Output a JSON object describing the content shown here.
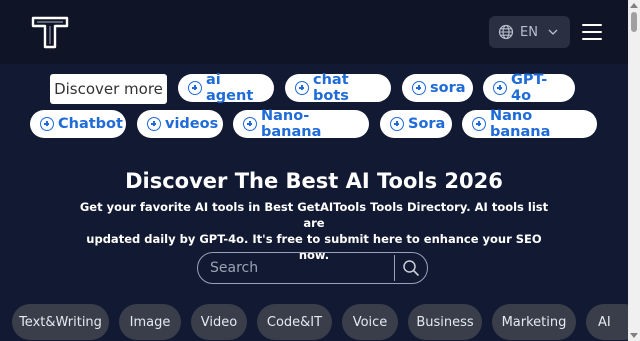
{
  "header": {
    "logo_letter": "T",
    "language": "EN"
  },
  "tags": {
    "discover_label": "Discover more",
    "row1": [
      "ai agent",
      "chat bots",
      "sora",
      "GPT-4o"
    ],
    "row2": [
      "Chatbot",
      "videos",
      "Nano-banana",
      "Sora",
      "Nano banana"
    ]
  },
  "hero": {
    "title": "Discover The Best AI Tools 2026",
    "subtitle_line1": "Get your favorite AI tools in Best GetAITools Tools Directory. AI tools list are",
    "subtitle_line2": "updated daily by GPT-4o. It's free to submit here to enhance your SEO now."
  },
  "search": {
    "placeholder": "Search"
  },
  "categories": [
    "Text&Writing",
    "Image",
    "Video",
    "Code&IT",
    "Voice",
    "Business",
    "Marketing",
    "AI"
  ],
  "colors": {
    "background": "#121a33",
    "header": "#0f1426",
    "tag_text": "#1f6bd8",
    "category_bg": "#3a3e4b"
  }
}
